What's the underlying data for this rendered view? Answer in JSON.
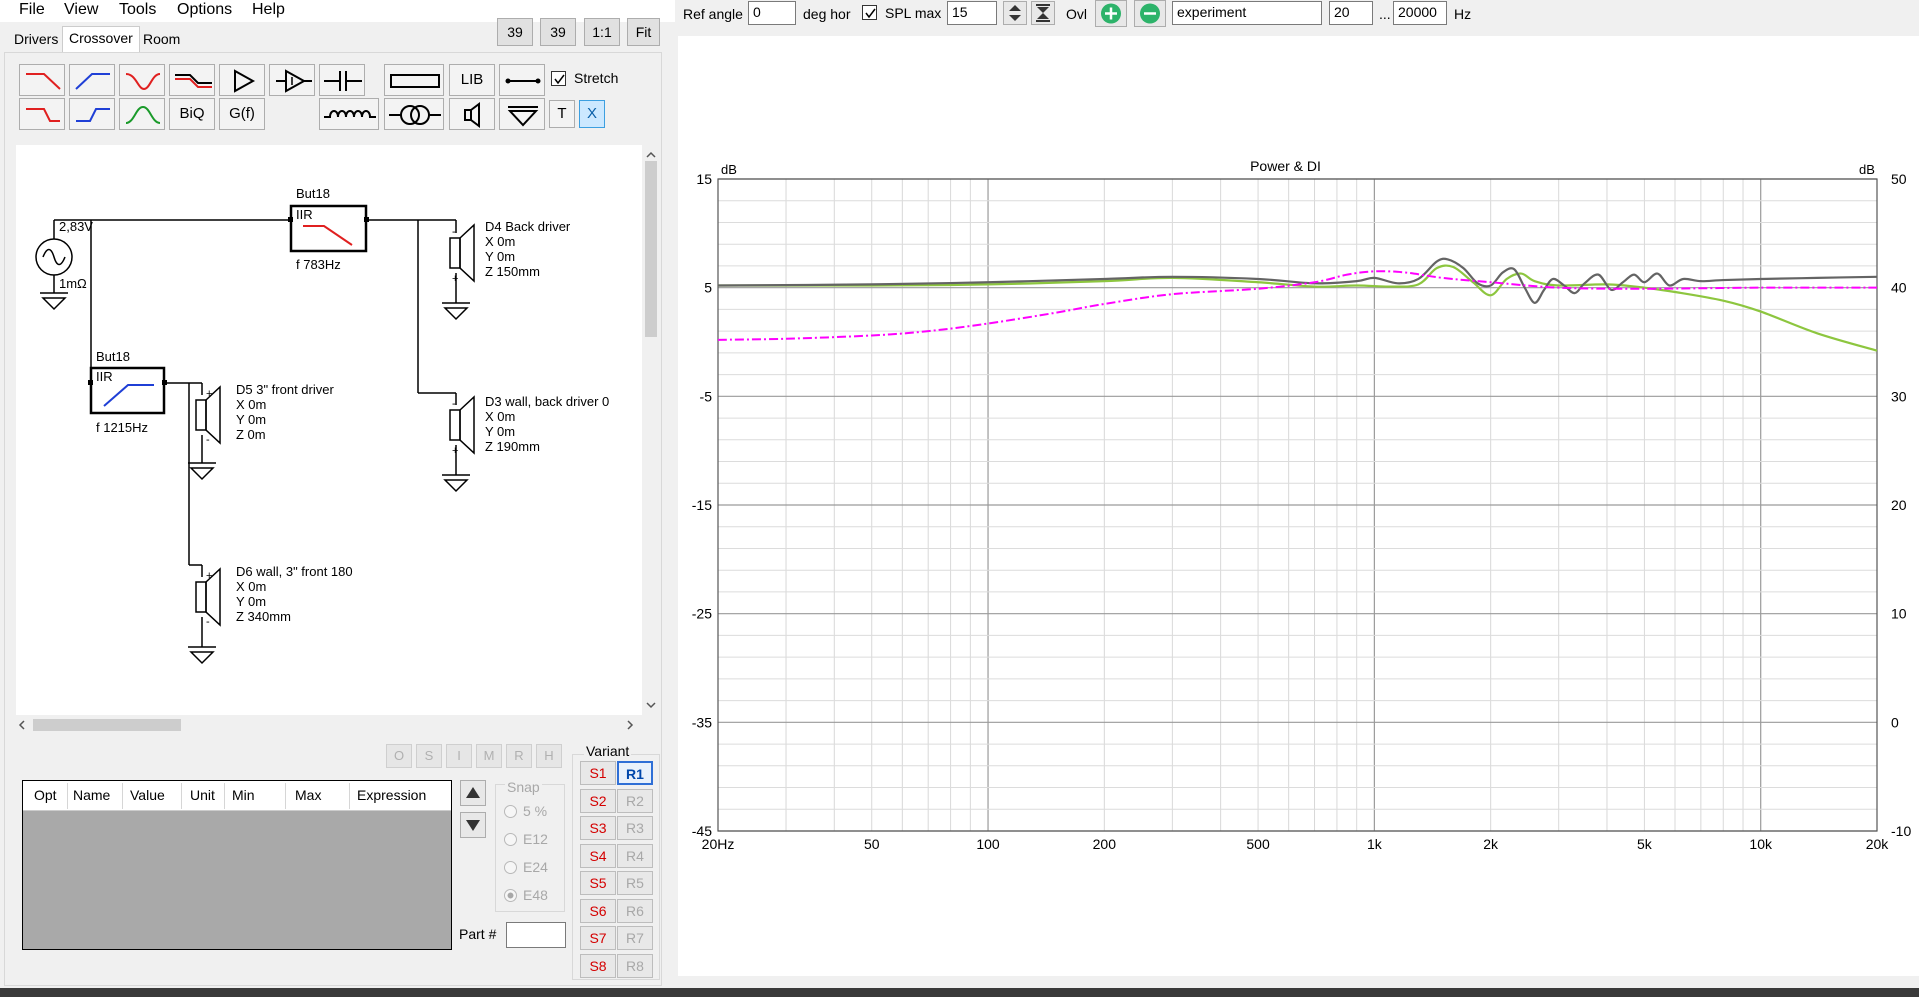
{
  "menu": [
    "File",
    "View",
    "Tools",
    "Options",
    "Help"
  ],
  "topbuttons": {
    "b1": "39",
    "b2": "39",
    "b3": "1:1",
    "b4": "Fit"
  },
  "tabs": [
    "Drivers",
    "Crossover",
    "Room"
  ],
  "toolbar": {
    "lib": "LIB",
    "stretch": "Stretch",
    "biq": "BiQ",
    "gf": "G(f)",
    "t": "T",
    "x": "X"
  },
  "schematic": {
    "source_voltage": "2,83V",
    "source_impedance": "1mΩ",
    "filter1": {
      "name": "But18",
      "type": "IIR",
      "freq": "f  783Hz"
    },
    "filter2": {
      "name": "But18",
      "type": "IIR",
      "freq": "f  1215Hz"
    },
    "driver_d4": {
      "name": "D4 Back driver",
      "x": "X 0m",
      "y": "Y 0m",
      "z": "Z 150mm"
    },
    "driver_d3": {
      "name": "D3 wall, back driver 0",
      "x": "X 0m",
      "y": "Y 0m",
      "z": "Z 190mm"
    },
    "driver_d5": {
      "name": "D5 3\" front driver",
      "x": "X 0m",
      "y": "Y 0m",
      "z": "Z 0m"
    },
    "driver_d6": {
      "name": "D6 wall, 3\" front 180",
      "x": "X 0m",
      "y": "Y 0m",
      "z": "Z 340mm"
    }
  },
  "smallbuttons": [
    "O",
    "S",
    "I",
    "M",
    "R",
    "H"
  ],
  "param_table": {
    "columns": [
      "Opt",
      "Name",
      "Value",
      "Unit",
      "Min",
      "Max",
      "Expression"
    ]
  },
  "snap": {
    "label": "Snap",
    "options": [
      "5 %",
      "E12",
      "E24",
      "E48"
    ]
  },
  "part_label": "Part #",
  "variant": {
    "label": "Variant",
    "s": [
      "S1",
      "S2",
      "S3",
      "S4",
      "S5",
      "S6",
      "S7",
      "S8"
    ],
    "r": [
      "R1",
      "R2",
      "R3",
      "R4",
      "R5",
      "R6",
      "R7",
      "R8"
    ],
    "selected": "R1"
  },
  "header": {
    "ref_angle_label": "Ref angle",
    "ref_angle_value": "0",
    "deg_label": "deg hor",
    "spl_label": "SPL max",
    "spl_value": "15",
    "ovl_label": "Ovl",
    "overlay_name": "experiment",
    "f_min": "20",
    "ellipsis": "...",
    "f_max": "20000",
    "hz": "Hz"
  },
  "chart_data": {
    "type": "line",
    "title": "Power & DI",
    "xlabel": "",
    "ylabel_left": "dB",
    "ylabel_right": "dB",
    "x_scale": "log",
    "xlim": [
      20,
      20000
    ],
    "ylim_left": [
      -45,
      15
    ],
    "ylim_right": [
      -10,
      50
    ],
    "x_ticks": [
      {
        "v": 20,
        "label": "20Hz"
      },
      {
        "v": 50,
        "label": "50"
      },
      {
        "v": 100,
        "label": "100"
      },
      {
        "v": 200,
        "label": "200"
      },
      {
        "v": 500,
        "label": "500"
      },
      {
        "v": 1000,
        "label": "1k"
      },
      {
        "v": 2000,
        "label": "2k"
      },
      {
        "v": 5000,
        "label": "5k"
      },
      {
        "v": 10000,
        "label": "10k"
      },
      {
        "v": 20000,
        "label": "20k"
      }
    ],
    "y_ticks_left": [
      15,
      5,
      -5,
      -15,
      -25,
      -35,
      -45
    ],
    "y_ticks_right": [
      50,
      40,
      30,
      20,
      10,
      0,
      -10
    ],
    "grid": true,
    "series": [
      {
        "color": "#8dc63f",
        "axis": "left",
        "points": [
          [
            20,
            5.2
          ],
          [
            50,
            5.2
          ],
          [
            100,
            5.3
          ],
          [
            200,
            5.6
          ],
          [
            300,
            5.9
          ],
          [
            500,
            5.5
          ],
          [
            700,
            5.1
          ],
          [
            900,
            5.2
          ],
          [
            1100,
            5.1
          ],
          [
            1300,
            5.3
          ],
          [
            1450,
            6.8
          ],
          [
            1600,
            6.9
          ],
          [
            1800,
            5.5
          ],
          [
            2000,
            4.3
          ],
          [
            2200,
            5.8
          ],
          [
            2400,
            6.3
          ],
          [
            2600,
            5.6
          ],
          [
            3000,
            5.2
          ],
          [
            4000,
            5.3
          ],
          [
            5000,
            5.0
          ],
          [
            6000,
            4.6
          ],
          [
            8000,
            3.8
          ],
          [
            10000,
            2.8
          ],
          [
            14000,
            0.8
          ],
          [
            20000,
            -0.8
          ]
        ]
      },
      {
        "color": "#646464",
        "axis": "left",
        "points": [
          [
            20,
            5.2
          ],
          [
            50,
            5.3
          ],
          [
            100,
            5.5
          ],
          [
            200,
            5.8
          ],
          [
            300,
            6.0
          ],
          [
            500,
            5.8
          ],
          [
            700,
            5.4
          ],
          [
            900,
            5.6
          ],
          [
            1000,
            5.9
          ],
          [
            1150,
            5.4
          ],
          [
            1300,
            5.8
          ],
          [
            1450,
            7.4
          ],
          [
            1550,
            7.6
          ],
          [
            1700,
            6.8
          ],
          [
            1850,
            5.4
          ],
          [
            2000,
            5.2
          ],
          [
            2150,
            6.4
          ],
          [
            2300,
            6.7
          ],
          [
            2450,
            5.0
          ],
          [
            2600,
            3.6
          ],
          [
            2750,
            4.8
          ],
          [
            2900,
            5.8
          ],
          [
            3100,
            5.2
          ],
          [
            3300,
            4.5
          ],
          [
            3500,
            5.4
          ],
          [
            3800,
            6.2
          ],
          [
            4100,
            4.8
          ],
          [
            4400,
            5.5
          ],
          [
            4700,
            6.2
          ],
          [
            5000,
            5.5
          ],
          [
            5400,
            6.3
          ],
          [
            5800,
            5.2
          ],
          [
            6300,
            5.8
          ],
          [
            7000,
            5.6
          ],
          [
            8000,
            5.7
          ],
          [
            10000,
            5.8
          ],
          [
            14000,
            5.9
          ],
          [
            20000,
            6.0
          ]
        ]
      },
      {
        "color": "#ff00ff",
        "dashed": true,
        "axis": "right",
        "points": [
          [
            20,
            35.2
          ],
          [
            30,
            35.3
          ],
          [
            50,
            35.6
          ],
          [
            70,
            36.0
          ],
          [
            100,
            36.7
          ],
          [
            150,
            37.7
          ],
          [
            200,
            38.5
          ],
          [
            300,
            39.4
          ],
          [
            500,
            39.9
          ],
          [
            700,
            40.5
          ],
          [
            850,
            41.2
          ],
          [
            1000,
            41.5
          ],
          [
            1200,
            41.4
          ],
          [
            1500,
            40.9
          ],
          [
            2000,
            40.5
          ],
          [
            3000,
            40.0
          ],
          [
            5000,
            39.9
          ],
          [
            10000,
            40.0
          ],
          [
            20000,
            40.0
          ]
        ]
      }
    ]
  }
}
